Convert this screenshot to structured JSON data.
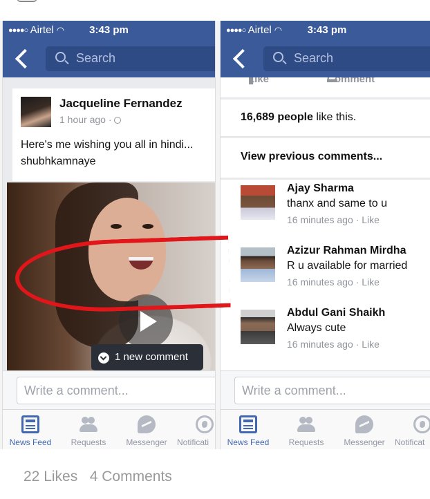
{
  "status": {
    "carrier": "Airtel",
    "time": "3:43 pm"
  },
  "search": {
    "placeholder": "Search"
  },
  "post": {
    "author": "Jacqueline Fernandez",
    "time": "1 hour ago",
    "text": "Here's me wishing you all in hindi... shubhkamnaye",
    "new_comment": "1 new comment"
  },
  "reactions": {
    "like": "Like",
    "comment": "Comment"
  },
  "likes": {
    "count": "16,689 people",
    "suffix": " like this."
  },
  "view_previous": "View previous comments...",
  "comments": [
    {
      "name": "Ajay Sharma",
      "text": "thanx and same to u",
      "time": "16 minutes ago",
      "action": "Like"
    },
    {
      "name": "Azizur Rahman Mirdha",
      "text": "R u available for married",
      "time": "16 minutes ago",
      "action": "Like"
    },
    {
      "name": "Abdul Gani Shaikh",
      "text": "Always cute",
      "time": "16 minutes ago",
      "action": "Like"
    }
  ],
  "write_comment": "Write a comment...",
  "tabs": [
    "News Feed",
    "Requests",
    "Messenger",
    "Notifications"
  ],
  "tabs_truncated": [
    "Notificati",
    "Notificat"
  ],
  "footer": {
    "likes": "22 Likes",
    "comments": "4 Comments"
  },
  "colors": {
    "brand": "#3b5a99",
    "highlight": "#e0161a"
  }
}
